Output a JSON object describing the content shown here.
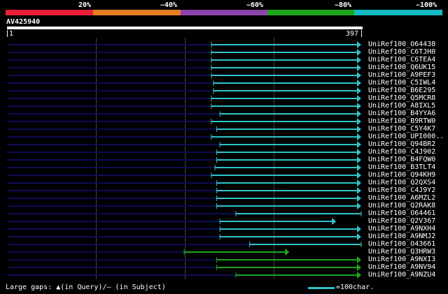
{
  "colors": {
    "segments": [
      "#e8203a",
      "#e67e22",
      "#8e44ad",
      "#1ea51e",
      "#14b9c3"
    ],
    "cyan": "#2ec4c8",
    "green": "#1ea51e",
    "navy": "#0c0c56"
  },
  "coverage_labels": [
    "20%",
    "~40%",
    "~60%",
    "~80%",
    "~100%"
  ],
  "query": {
    "id": "AV425940",
    "start": "1",
    "end": "397"
  },
  "hits": [
    {
      "label": "UniRef100_O64438",
      "start": 0.577,
      "end": 1.0,
      "color": "cyan",
      "arrow": true
    },
    {
      "label": "UniRef100_C6TJH0",
      "start": 0.577,
      "end": 1.0,
      "color": "cyan",
      "arrow": true
    },
    {
      "label": "UniRef100_C6TEA4",
      "start": 0.577,
      "end": 1.0,
      "color": "cyan",
      "arrow": true
    },
    {
      "label": "UniRef100_Q6UK15",
      "start": 0.577,
      "end": 1.0,
      "color": "cyan",
      "arrow": true
    },
    {
      "label": "UniRef100_A9PEF3",
      "start": 0.577,
      "end": 1.0,
      "color": "cyan",
      "arrow": true
    },
    {
      "label": "UniRef100_C5IWL4",
      "start": 0.583,
      "end": 1.0,
      "color": "cyan",
      "arrow": true
    },
    {
      "label": "UniRef100_B6E295",
      "start": 0.583,
      "end": 1.0,
      "color": "cyan",
      "arrow": true
    },
    {
      "label": "UniRef100_Q5MCR8",
      "start": 0.577,
      "end": 1.0,
      "color": "cyan",
      "arrow": true
    },
    {
      "label": "UniRef100_A8IXL5",
      "start": 0.577,
      "end": 1.0,
      "color": "cyan",
      "arrow": true
    },
    {
      "label": "UniRef100_B4YYA6",
      "start": 0.601,
      "end": 1.0,
      "color": "cyan",
      "arrow": true
    },
    {
      "label": "UniRef100_B9RTW0",
      "start": 0.577,
      "end": 1.0,
      "color": "cyan",
      "arrow": true
    },
    {
      "label": "UniRef100_C5Y4K7",
      "start": 0.592,
      "end": 1.0,
      "color": "cyan",
      "arrow": true
    },
    {
      "label": "UniRef100_UPI000..",
      "start": 0.577,
      "end": 1.0,
      "color": "cyan",
      "arrow": true
    },
    {
      "label": "UniRef100_Q94BR2",
      "start": 0.601,
      "end": 1.0,
      "color": "cyan",
      "arrow": true
    },
    {
      "label": "UniRef100_C4J902",
      "start": 0.592,
      "end": 1.0,
      "color": "cyan",
      "arrow": true
    },
    {
      "label": "UniRef100_B4FQW0",
      "start": 0.592,
      "end": 1.0,
      "color": "cyan",
      "arrow": true
    },
    {
      "label": "UniRef100_B3TLT4",
      "start": 0.587,
      "end": 1.0,
      "color": "cyan",
      "arrow": true
    },
    {
      "label": "UniRef100_Q94KH9",
      "start": 0.577,
      "end": 1.0,
      "color": "cyan",
      "arrow": true
    },
    {
      "label": "UniRef100_Q2QXS4",
      "start": 0.592,
      "end": 1.0,
      "color": "cyan",
      "arrow": true
    },
    {
      "label": "UniRef100_C4J9Y2",
      "start": 0.592,
      "end": 1.0,
      "color": "cyan",
      "arrow": true
    },
    {
      "label": "UniRef100_A6MZL2",
      "start": 0.592,
      "end": 1.0,
      "color": "cyan",
      "arrow": true
    },
    {
      "label": "UniRef100_Q2RAK8",
      "start": 0.592,
      "end": 1.0,
      "color": "cyan",
      "arrow": true
    },
    {
      "label": "UniRef100_O64461",
      "start": 0.646,
      "end": 1.0,
      "color": "cyan",
      "arrow": false
    },
    {
      "label": "UniRef100_Q2V367",
      "start": 0.601,
      "end": 0.929,
      "color": "cyan",
      "arrow": true
    },
    {
      "label": "UniRef100_A9NXH4",
      "start": 0.601,
      "end": 1.0,
      "color": "cyan",
      "arrow": true
    },
    {
      "label": "UniRef100_A9NMJ2",
      "start": 0.601,
      "end": 1.0,
      "color": "cyan",
      "arrow": true
    },
    {
      "label": "UniRef100_O43661",
      "start": 0.685,
      "end": 1.0,
      "color": "cyan",
      "arrow": false
    },
    {
      "label": "UniRef100_Q3HRW3",
      "start": 0.5,
      "end": 0.797,
      "color": "green",
      "arrow": true
    },
    {
      "label": "UniRef100_A9NXI3",
      "start": 0.592,
      "end": 1.0,
      "color": "green",
      "arrow": true
    },
    {
      "label": "UniRef100_A9NV94",
      "start": 0.592,
      "end": 1.0,
      "color": "green",
      "arrow": true
    },
    {
      "label": "UniRef100_A9NZU4",
      "start": 0.646,
      "end": 1.0,
      "color": "green",
      "arrow": true
    }
  ],
  "footer": {
    "gaps_text": "Large gaps: ▲(in Query)/– (in Subject)",
    "scale_text": "=100char."
  }
}
